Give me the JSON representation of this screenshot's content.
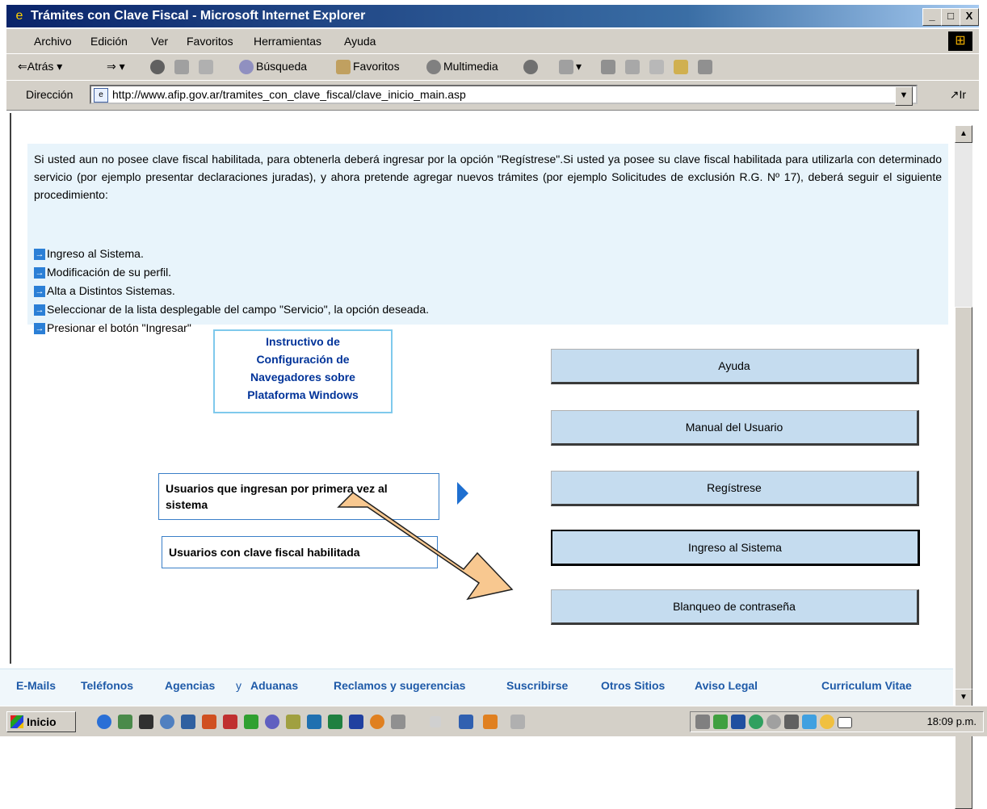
{
  "window": {
    "title": "Trámites con Clave Fiscal - Microsoft Internet Explorer",
    "min_label": "_",
    "max_label": "□",
    "close_label": "X"
  },
  "menu": [
    "Archivo",
    "Edición",
    "Ver",
    "Favoritos",
    "Herramientas",
    "Ayuda"
  ],
  "toolbar": {
    "back": "Atrás",
    "search": "Búsqueda",
    "favorites": "Favoritos",
    "multimedia": "Multimedia"
  },
  "address": {
    "label": "Dirección",
    "url": "http://www.afip.gov.ar/tramites_con_clave_fiscal/clave_inicio_main.asp",
    "go": "Ir"
  },
  "content": {
    "intro": "Si usted aun no posee clave fiscal habilitada, para obtenerla deberá ingresar por la opción \"Regístrese\".Si usted ya posee su clave fiscal habilitada para utilizarla con determinado servicio (por ejemplo presentar declaraciones juradas), y ahora pretende agregar nuevos trámites (por ejemplo Solicitudes de exclusión R.G. Nº 17), deberá seguir el siguiente procedimiento:",
    "steps": [
      "Ingreso al Sistema.",
      "Modificación de su perfil.",
      "Alta a Distintos Sistemas.",
      "Seleccionar de la lista desplegable del campo \"Servicio\", la opción deseada.",
      "Presionar el botón \"Ingresar\""
    ],
    "instructivo_line1": "Instructivo de",
    "instructivo_line2": "Configuración de",
    "instructivo_line3": "Navegadores sobre",
    "instructivo_line4": "Plataforma Windows",
    "first_time_users": "Usuarios que ingresan por primera vez al sistema",
    "fiscal_key_users": "Usuarios con clave fiscal habilitada",
    "buttons": {
      "help": "Ayuda",
      "manual": "Manual del Usuario",
      "register": "Regístrese",
      "login": "Ingreso al Sistema",
      "reset_password": "Blanqueo de contraseña"
    }
  },
  "footer": {
    "emails": "E-Mails",
    "phones": "Teléfonos",
    "agencies": "Agencias",
    "and": "y",
    "customs": "Aduanas",
    "claims": "Reclamos y sugerencias",
    "subscribe": "Suscribirse",
    "other_sites": "Otros Sitios",
    "legal": "Aviso Legal",
    "cv": "Curriculum Vitae"
  },
  "taskbar": {
    "start": "Inicio",
    "clock": "18:09 p.m."
  },
  "colors": {
    "titlebar": "#0a246a",
    "link_blue": "#1e5aa8",
    "info_bg": "#e8f4fb",
    "button_bg": "#c5dcef",
    "arrow_fill": "#f8c890"
  }
}
